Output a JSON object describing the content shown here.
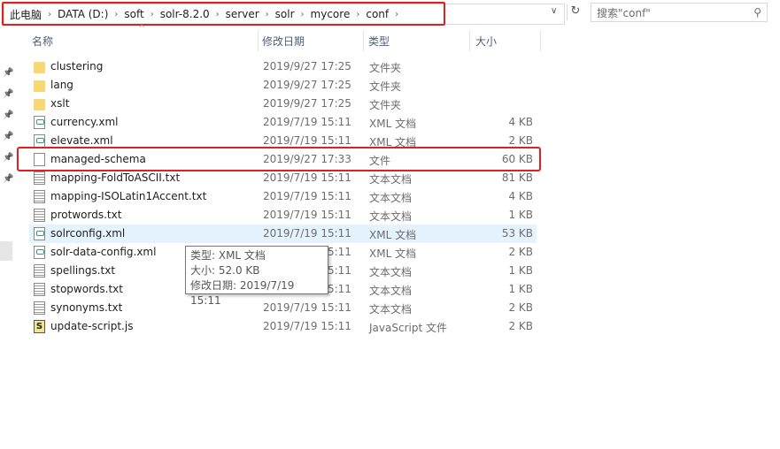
{
  "address": {
    "crumbs": [
      "此电脑",
      "DATA (D:)",
      "soft",
      "solr-8.2.0",
      "server",
      "solr",
      "mycore",
      "conf"
    ],
    "search_placeholder": "搜索\"conf\""
  },
  "columns": {
    "name": "名称",
    "date": "修改日期",
    "type": "类型",
    "size": "大小"
  },
  "files": [
    {
      "name": "clustering",
      "date": "2019/9/27 17:25",
      "type": "文件夹",
      "size": "",
      "icon": "folder"
    },
    {
      "name": "lang",
      "date": "2019/9/27 17:25",
      "type": "文件夹",
      "size": "",
      "icon": "folder"
    },
    {
      "name": "xslt",
      "date": "2019/9/27 17:25",
      "type": "文件夹",
      "size": "",
      "icon": "folder"
    },
    {
      "name": "currency.xml",
      "date": "2019/7/19 15:11",
      "type": "XML 文档",
      "size": "4 KB",
      "icon": "xml"
    },
    {
      "name": "elevate.xml",
      "date": "2019/7/19 15:11",
      "type": "XML 文档",
      "size": "2 KB",
      "icon": "xml"
    },
    {
      "name": "managed-schema",
      "date": "2019/9/27 17:33",
      "type": "文件",
      "size": "60 KB",
      "icon": "file"
    },
    {
      "name": "mapping-FoldToASCII.txt",
      "date": "2019/7/19 15:11",
      "type": "文本文档",
      "size": "81 KB",
      "icon": "txt"
    },
    {
      "name": "mapping-ISOLatin1Accent.txt",
      "date": "2019/7/19 15:11",
      "type": "文本文档",
      "size": "4 KB",
      "icon": "txt"
    },
    {
      "name": "protwords.txt",
      "date": "2019/7/19 15:11",
      "type": "文本文档",
      "size": "1 KB",
      "icon": "txt"
    },
    {
      "name": "solrconfig.xml",
      "date": "2019/7/19 15:11",
      "type": "XML 文档",
      "size": "53 KB",
      "icon": "xml"
    },
    {
      "name": "solr-data-config.xml",
      "date": "2019/7/19 15:11",
      "type": "XML 文档",
      "size": "2 KB",
      "icon": "xml"
    },
    {
      "name": "spellings.txt",
      "date": "2019/7/19 15:11",
      "type": "文本文档",
      "size": "1 KB",
      "icon": "txt"
    },
    {
      "name": "stopwords.txt",
      "date": "2019/7/19 15:11",
      "type": "文本文档",
      "size": "1 KB",
      "icon": "txt"
    },
    {
      "name": "synonyms.txt",
      "date": "2019/7/19 15:11",
      "type": "文本文档",
      "size": "2 KB",
      "icon": "txt"
    },
    {
      "name": "update-script.js",
      "date": "2019/7/19 15:11",
      "type": "JavaScript 文件",
      "size": "2 KB",
      "icon": "js"
    }
  ],
  "hovered_index": 9,
  "tooltip": {
    "type": "类型: XML 文档",
    "size": "大小: 52.0 KB",
    "date": "修改日期: 2019/7/19 15:11"
  },
  "highlight_color": "#e02020"
}
